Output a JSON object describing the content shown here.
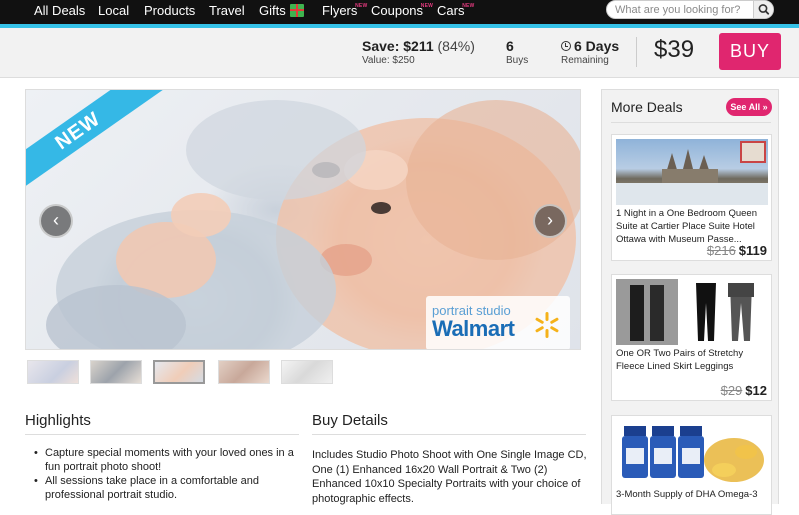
{
  "nav": {
    "items": [
      "All Deals",
      "Local",
      "Products",
      "Travel",
      "Gifts",
      "Flyers",
      "Coupons",
      "Cars"
    ],
    "new_badge": "NEW"
  },
  "search": {
    "placeholder": "What are you looking for?"
  },
  "deal": {
    "save_label": "Save: $211",
    "save_pct": "(84%)",
    "value_label": "Value: $250",
    "buys_count": "6",
    "buys_label": "Buys",
    "days": "6 Days",
    "days_label": "Remaining",
    "price": "$39",
    "buy_label": "BUY"
  },
  "hero": {
    "ribbon": "NEW",
    "prev": "‹",
    "next": "›",
    "brand_line1": "portrait studio",
    "brand_line2": "Walmart"
  },
  "highlights": {
    "title": "Highlights",
    "items": [
      "Capture special moments with your loved ones in a fun portrait photo shoot!",
      "All sessions take place in a comfortable and professional portrait studio."
    ]
  },
  "buy_details": {
    "title": "Buy Details",
    "text": "Includes Studio Photo Shoot with One Single Image CD, One (1) Enhanced 16x20 Wall Portrait & Two (2) Enhanced 10x10 Specialty Portraits with your choice of photographic effects."
  },
  "sidebar": {
    "title": "More Deals",
    "see_all": "See All »",
    "cards": [
      {
        "text": "1 Night in a One Bedroom Queen Suite at Cartier Place Suite Hotel Ottawa with Museum Passe...",
        "old_price": "$216",
        "new_price": "$119"
      },
      {
        "text": "One OR Two Pairs of Stretchy Fleece Lined Skirt Leggings",
        "old_price": "$29",
        "new_price": "$12"
      },
      {
        "text": "3-Month Supply of DHA Omega-3"
      }
    ]
  },
  "colors": {
    "accent": "#35c2e8",
    "brand_pink": "#e0266f"
  }
}
